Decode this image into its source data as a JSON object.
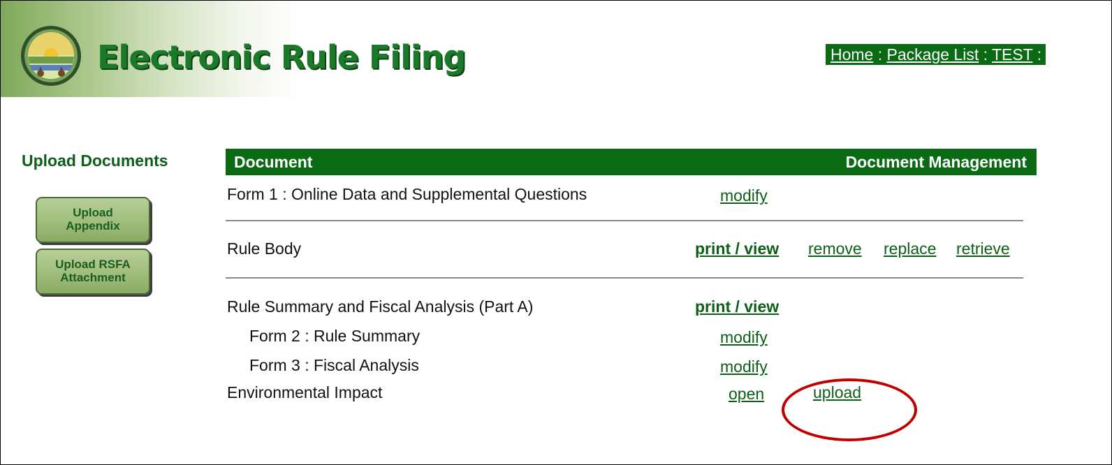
{
  "header": {
    "app_title": "Electronic Rule Filing",
    "breadcrumb": {
      "home": "Home",
      "package_list": "Package List",
      "current": "TEST",
      "separator": " : "
    }
  },
  "sidebar": {
    "title": "Upload Documents",
    "buttons": [
      {
        "label": "Upload\nAppendix"
      },
      {
        "label": "Upload RSFA\nAttachment"
      }
    ]
  },
  "table": {
    "headers": {
      "document": "Document",
      "management": "Document Management"
    },
    "rows": [
      {
        "label": "Form 1 : Online Data and Supplemental Questions",
        "actions": [
          "modify"
        ]
      },
      {
        "label": "Rule Body",
        "actions": [
          "print / view",
          "remove",
          "replace",
          "retrieve"
        ]
      },
      {
        "label": "Rule Summary and Fiscal Analysis (Part A)",
        "actions": [
          "print / view"
        ]
      },
      {
        "label": "Form 2 : Rule Summary",
        "actions": [
          "modify"
        ]
      },
      {
        "label": "Form 3 : Fiscal Analysis",
        "actions": [
          "modify"
        ]
      },
      {
        "label": "Environmental Impact",
        "actions": [
          "open",
          "upload"
        ]
      }
    ]
  },
  "colors": {
    "brand_green": "#0a6b14",
    "link_green": "#0d5f18",
    "highlight_red": "#c00000"
  }
}
